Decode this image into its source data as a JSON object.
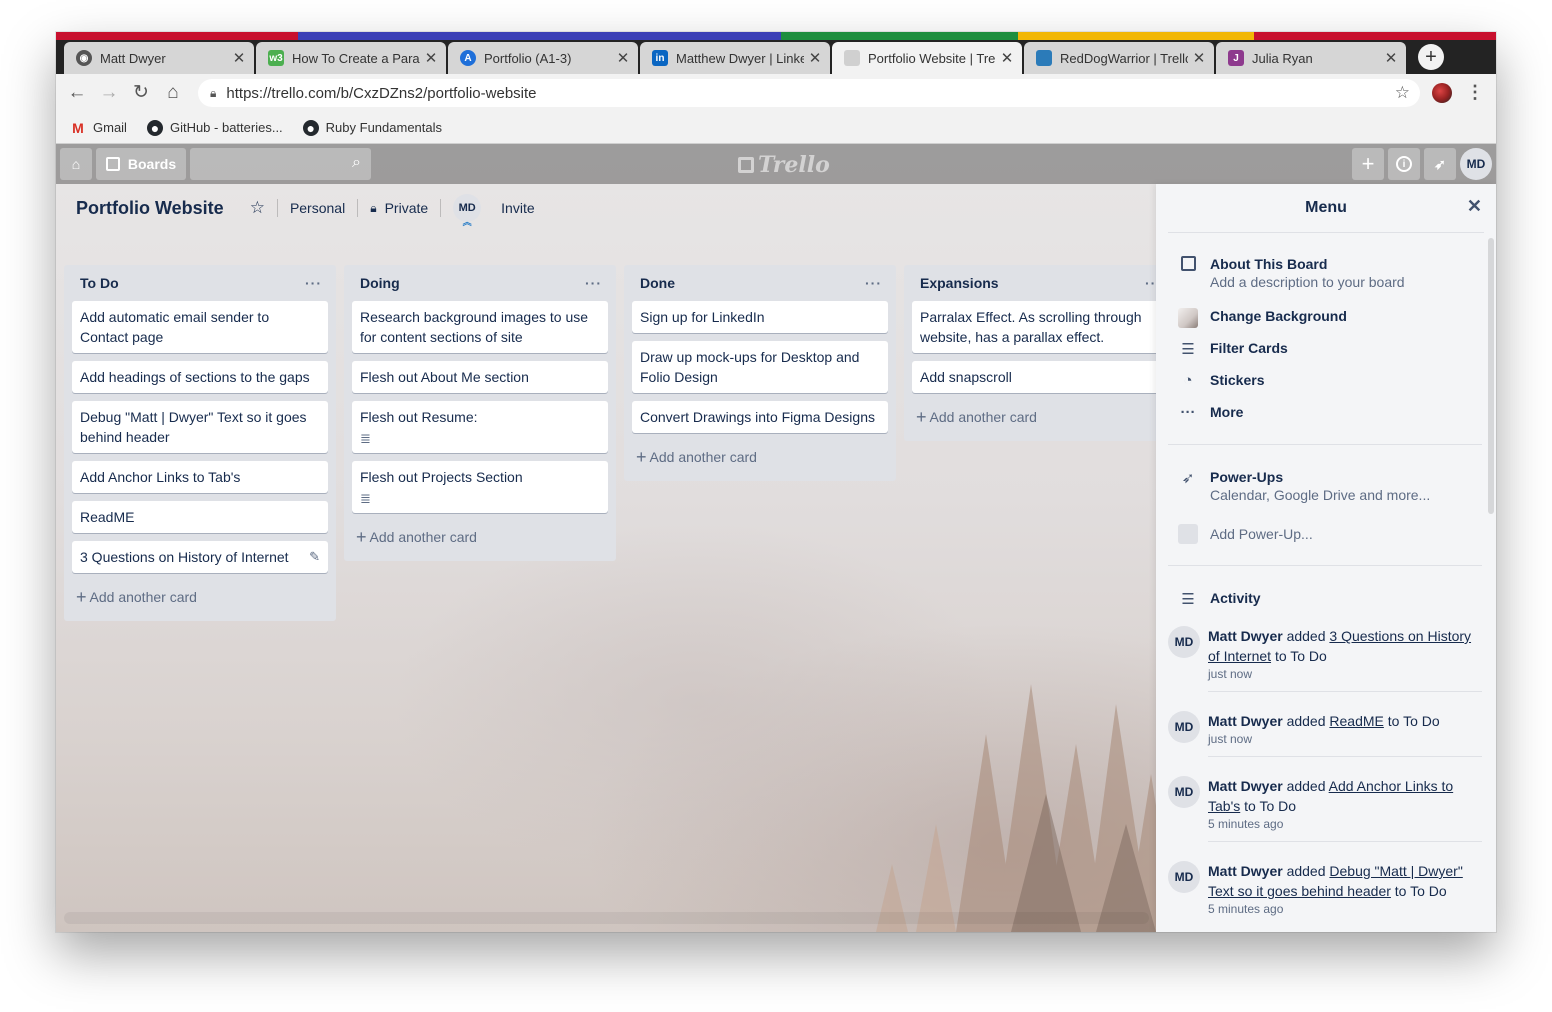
{
  "browser": {
    "tabs": [
      {
        "title": "Matt Dwyer",
        "favicon": "globe-icon",
        "color": "#555555"
      },
      {
        "title": "How To Create a Parall",
        "favicon": "w3-icon",
        "color": "#4caf50"
      },
      {
        "title": "Portfolio (A1-3)",
        "favicon": "assignment-icon",
        "color": "#1e6fd9"
      },
      {
        "title": "Matthew Dwyer | Linkec",
        "favicon": "linkedin-icon",
        "color": "#0a66c2"
      },
      {
        "title": "Portfolio Website | Trello",
        "favicon": "trello-icon",
        "color": "#bbbbbb"
      },
      {
        "title": "RedDogWarrior | Trello",
        "favicon": "trello-icon",
        "color": "#2b7bb9"
      },
      {
        "title": "Julia Ryan",
        "favicon": "j-icon",
        "color": "#8e3a8e"
      }
    ],
    "active_tab": 4,
    "url": "https://trello.com/b/CxzDZns2/portfolio-website",
    "bookmarks": [
      "Gmail",
      "GitHub - batteries...",
      "Ruby Fundamentals"
    ]
  },
  "trello": {
    "boards_label": "Boards",
    "logo": "Trello",
    "user_initials": "MD",
    "board": {
      "title": "Portfolio Website",
      "team": "Personal",
      "visibility": "Private",
      "invite": "Invite"
    },
    "lists": [
      {
        "title": "To Do",
        "cards": [
          "Add automatic email sender to Contact page",
          "Add headings of sections to the gaps",
          "Debug \"Matt | Dwyer\" Text so it goes behind header",
          "Add Anchor Links to Tab's",
          "ReadME",
          "3 Questions on History of Internet"
        ],
        "add": "Add another card"
      },
      {
        "title": "Doing",
        "cards": [
          "Research background images to use for content sections of site",
          "Flesh out About Me section",
          "Flesh out Resume:",
          "Flesh out Projects Section"
        ],
        "add": "Add another card"
      },
      {
        "title": "Done",
        "cards": [
          "Sign up for LinkedIn",
          "Draw up mock-ups for Desktop and Folio Design",
          "Convert Drawings into Figma Designs"
        ],
        "add": "Add another card"
      },
      {
        "title": "Expansions",
        "cards": [
          "Parralax Effect. As scrolling through website, has a parallax effect.",
          "Add snapscroll"
        ],
        "add": "Add another card"
      }
    ],
    "menu": {
      "title": "Menu",
      "about_title": "About This Board",
      "about_sub": "Add a description to your board",
      "change_bg": "Change Background",
      "filter": "Filter Cards",
      "stickers": "Stickers",
      "more": "More",
      "powerups_title": "Power-Ups",
      "powerups_sub": "Calendar, Google Drive and more...",
      "add_powerup": "Add Power-Up...",
      "activity_title": "Activity",
      "activity": [
        {
          "user": "Matt Dwyer",
          "verb": "added",
          "card": "3 Questions on History of Internet",
          "to": "to To Do",
          "when": "just now"
        },
        {
          "user": "Matt Dwyer",
          "verb": "added",
          "card": "ReadME",
          "to": "to To Do",
          "when": "just now"
        },
        {
          "user": "Matt Dwyer",
          "verb": "added",
          "card": "Add Anchor Links to Tab's",
          "to": "to To Do",
          "when": "5 minutes ago"
        },
        {
          "user": "Matt Dwyer",
          "verb": "added",
          "card": "Debug \"Matt | Dwyer\" Text so it goes behind header",
          "to": "to To Do",
          "when": "5 minutes ago"
        }
      ]
    }
  }
}
